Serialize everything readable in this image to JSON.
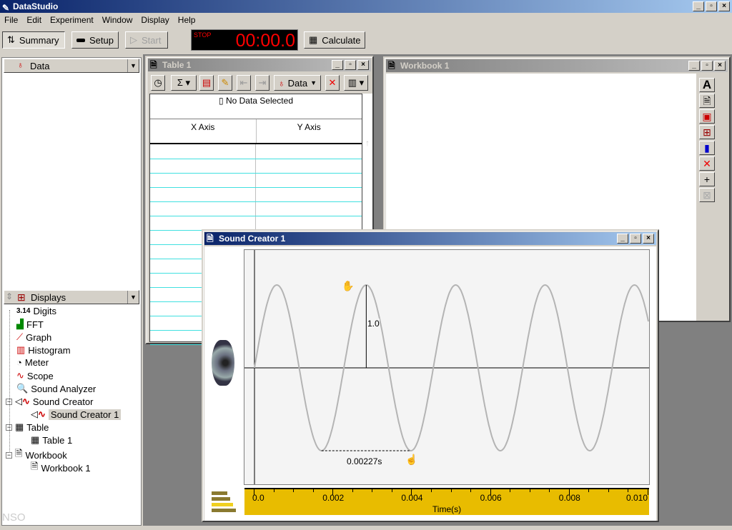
{
  "app": {
    "title": "DataStudio"
  },
  "menu": [
    "File",
    "Edit",
    "Experiment",
    "Window",
    "Display",
    "Help"
  ],
  "toolbar": {
    "summary": "Summary",
    "setup": "Setup",
    "start": "Start",
    "stop_label": "STOP",
    "timer": "00:00.0",
    "calculate": "Calculate"
  },
  "data_panel": {
    "label": "Data"
  },
  "displays_panel": {
    "label": "Displays",
    "items": [
      {
        "label": "Digits",
        "icon": "digits-icon",
        "glyph": "3.14"
      },
      {
        "label": "FFT",
        "icon": "fft-icon"
      },
      {
        "label": "Graph",
        "icon": "graph-icon"
      },
      {
        "label": "Histogram",
        "icon": "histogram-icon"
      },
      {
        "label": "Meter",
        "icon": "meter-icon"
      },
      {
        "label": "Scope",
        "icon": "scope-icon"
      },
      {
        "label": "Sound Analyzer",
        "icon": "sound-analyzer-icon"
      },
      {
        "label": "Sound Creator",
        "icon": "speaker-icon",
        "children": [
          {
            "label": "Sound Creator 1",
            "selected": true
          }
        ]
      },
      {
        "label": "Table",
        "icon": "table-icon",
        "children": [
          {
            "label": "Table 1"
          }
        ]
      },
      {
        "label": "Workbook",
        "icon": "workbook-icon",
        "children": [
          {
            "label": "Workbook 1"
          }
        ]
      }
    ]
  },
  "watermark": "NSO",
  "table_window": {
    "title": "Table 1",
    "data_button": "Data",
    "status": "No Data Selected",
    "columns": [
      "X Axis",
      "Y Axis"
    ]
  },
  "workbook_window": {
    "title": "Workbook 1"
  },
  "sound_window": {
    "title": "Sound Creator 1",
    "amplitude_label": "1.0",
    "period_label": "0.00227s"
  },
  "chart_data": {
    "type": "line",
    "xlabel": "Time(s)",
    "xlim": [
      0,
      0.01
    ],
    "ylim": [
      -1.4,
      1.4
    ],
    "x_ticks": [
      "0.0",
      "0.002",
      "0.004",
      "0.006",
      "0.008",
      "0.010"
    ],
    "series": [
      {
        "function": "sine",
        "amplitude": 1.0,
        "period": 0.00227,
        "color": "#b0b0b0"
      }
    ],
    "grid": false
  },
  "colors": {
    "title_start": "#0a246a",
    "title_end": "#a6caf0",
    "axis_bar": "#e8bc00",
    "timer_text": "#ff0000"
  }
}
